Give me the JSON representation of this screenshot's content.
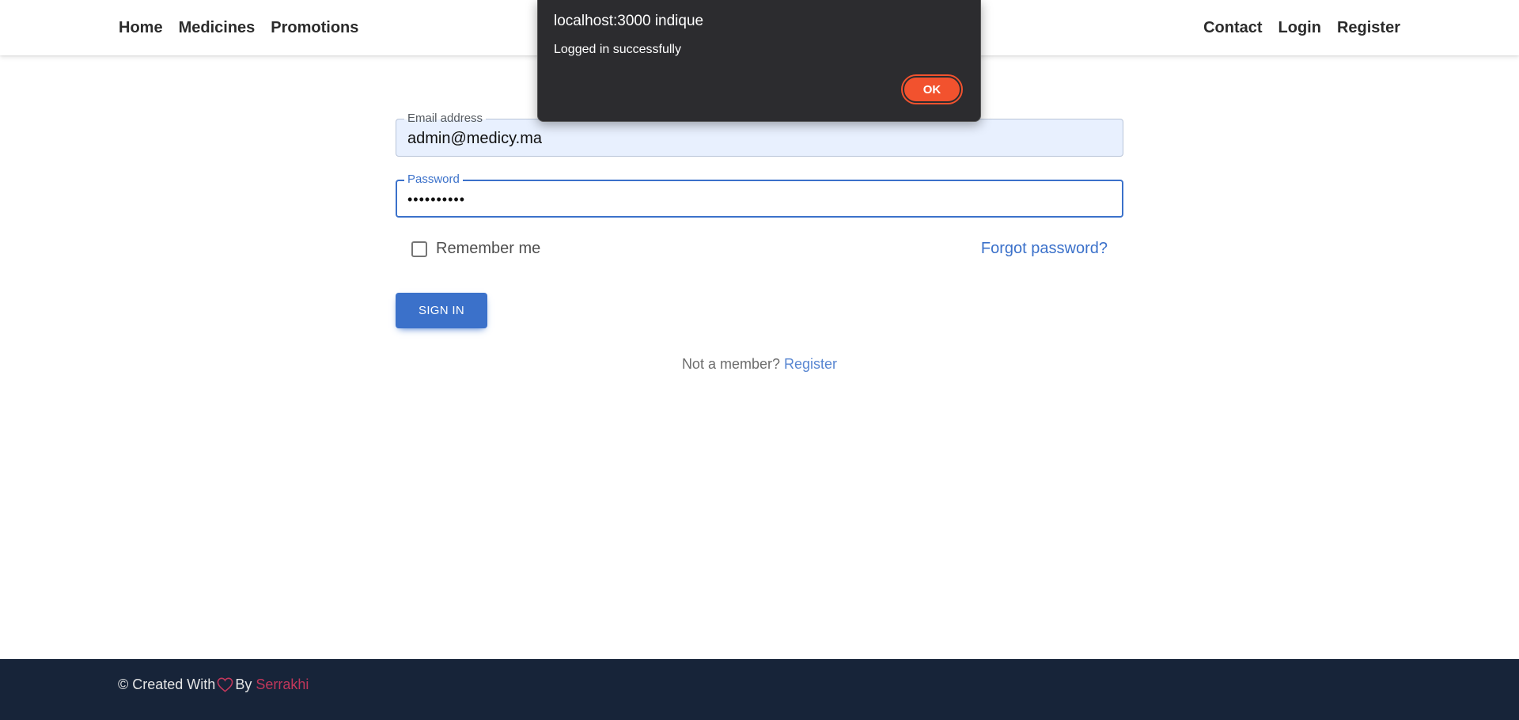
{
  "nav": {
    "left": [
      "Home",
      "Medicines",
      "Promotions"
    ],
    "right": [
      "Contact",
      "Login",
      "Register"
    ]
  },
  "form": {
    "email": {
      "label": "Email address",
      "value": "admin@medicy.ma"
    },
    "password": {
      "label": "Password",
      "value": "••••••••••"
    },
    "remember_label": "Remember me",
    "remember_checked": false,
    "forgot_link": "Forgot password?",
    "signin_button": "SIGN IN",
    "member_text": "Not a member?",
    "register_link": "Register"
  },
  "footer": {
    "prefix": "© Created With",
    "icon": "heart-icon",
    "by": "By",
    "author": "Serrakhi"
  },
  "dialog": {
    "title": "localhost:3000 indique",
    "message": "Logged in successfully",
    "ok_button": "OK"
  },
  "colors": {
    "primary": "#3b71ca",
    "footer_bg": "#172439",
    "heart": "#c2375b",
    "dialog_bg": "#2c2c2f",
    "dialog_button": "#f2522e"
  }
}
